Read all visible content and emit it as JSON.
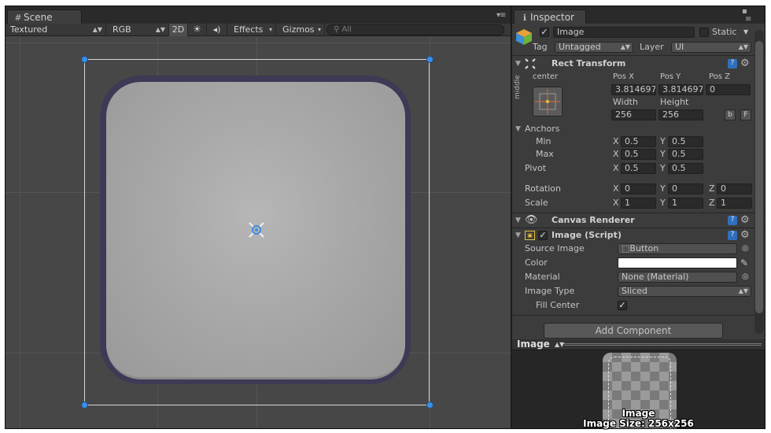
{
  "scene_tab": {
    "label": "Scene",
    "icon": "grid-icon"
  },
  "scene_toolbar": {
    "render_mode": "Textured",
    "color_mode": "RGB",
    "mode_2d": "2D",
    "lighting_icon": "sun-icon",
    "audio_icon": "speaker-icon",
    "effects": "Effects",
    "gizmos": "Gizmos",
    "search_placeholder": "All"
  },
  "inspector_tab": {
    "label": "Inspector",
    "icon": "info-icon"
  },
  "object_header": {
    "name": "Image",
    "active": true,
    "static_label": "Static",
    "static": false,
    "tag_label": "Tag",
    "tag_value": "Untagged",
    "layer_label": "Layer",
    "layer_value": "UI"
  },
  "rect_transform": {
    "title": "Rect Transform",
    "anchor_h": "center",
    "anchor_v": "middle",
    "pos_x_label": "Pos X",
    "pos_y_label": "Pos Y",
    "pos_z_label": "Pos Z",
    "pos_x": "3.814697",
    "pos_y": "3.814697",
    "pos_z": "0",
    "width_label": "Width",
    "height_label": "Height",
    "width": "256",
    "height": "256",
    "blueprint_btn": "b",
    "raw_btn": "F",
    "anchors_label": "Anchors",
    "min_label": "Min",
    "max_label": "Max",
    "anchor_min_x": "0.5",
    "anchor_min_y": "0.5",
    "anchor_max_x": "0.5",
    "anchor_max_y": "0.5",
    "pivot_label": "Pivot",
    "pivot_x": "0.5",
    "pivot_y": "0.5",
    "rotation_label": "Rotation",
    "rot_x": "0",
    "rot_y": "0",
    "rot_z": "0",
    "scale_label": "Scale",
    "scale_x": "1",
    "scale_y": "1",
    "scale_z": "1",
    "x": "X",
    "y": "Y",
    "z": "Z"
  },
  "canvas_renderer": {
    "title": "Canvas Renderer"
  },
  "image_script": {
    "title": "Image (Script)",
    "enabled": true,
    "source_image_label": "Source Image",
    "source_image_value": "Button",
    "color_label": "Color",
    "color_value": "#ffffff",
    "material_label": "Material",
    "material_value": "None (Material)",
    "image_type_label": "Image Type",
    "image_type_value": "Sliced",
    "fill_center_label": "Fill Center",
    "fill_center": true
  },
  "add_component": "Add Component",
  "preview": {
    "title": "Image",
    "name": "Image",
    "size_text": "Image Size: 256x256"
  },
  "colors": {
    "handle": "#3d8ee6",
    "help": "#2f6fbf",
    "panel_bg": "#3c3c3c",
    "scene_bg": "#474747"
  }
}
